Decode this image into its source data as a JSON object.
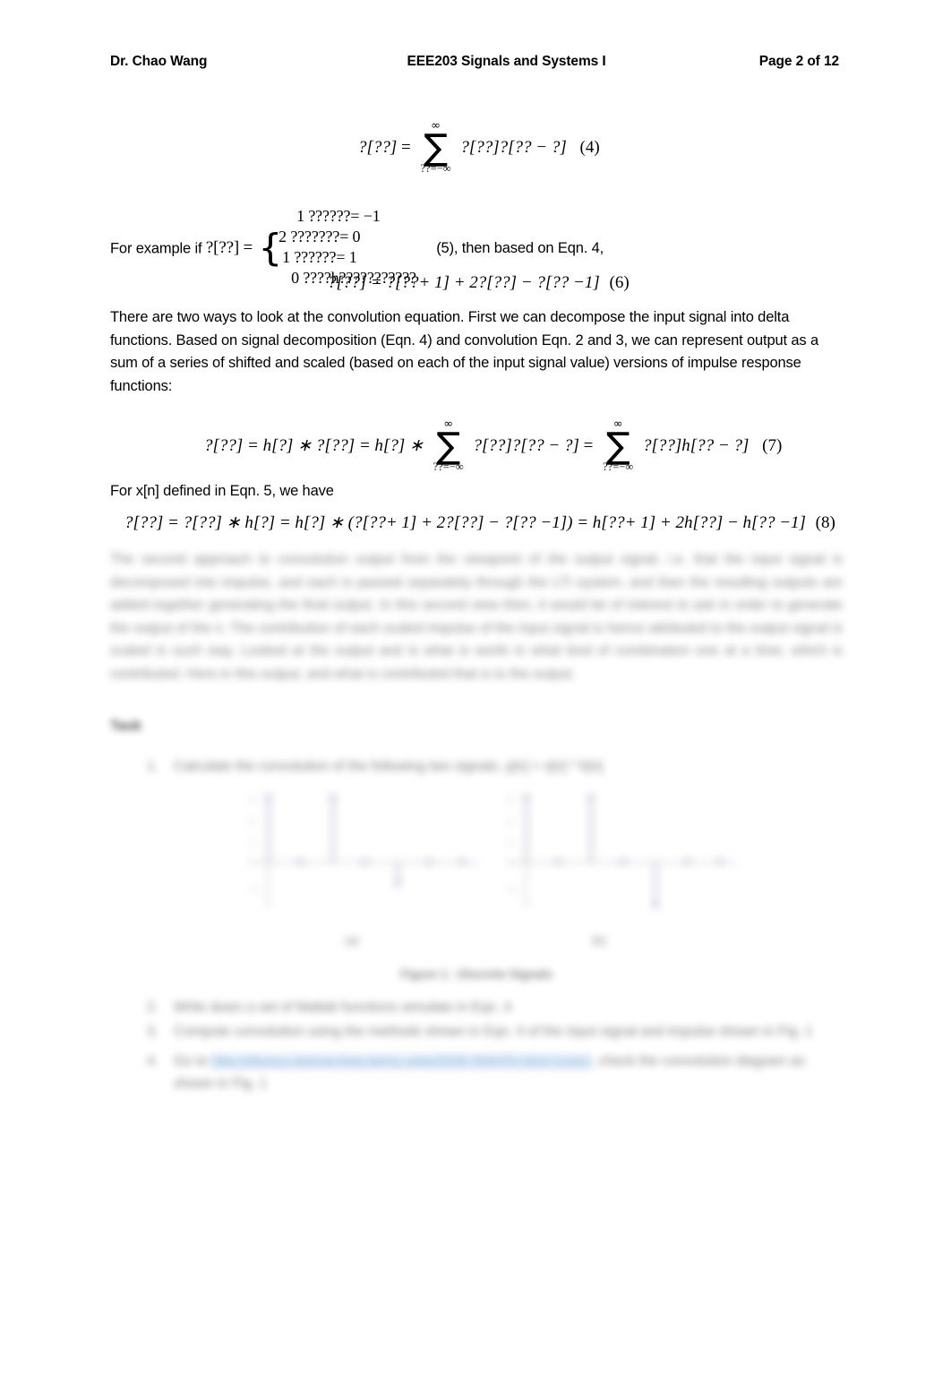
{
  "header": {
    "left": "Dr. Chao Wang",
    "center": "EEE203 Signals and Systems I",
    "right": "Page 2 of 12"
  },
  "equations": {
    "eqn4": {
      "lhs": "?[??]",
      "equals": "=",
      "sum_top": "∞",
      "sum_bottom": "??=−∞",
      "summand": "?[??]?[?? − ?]",
      "number": "(4)"
    },
    "eqn5": {
      "lead_text": "For example if",
      "lhs": "?[??]",
      "equals": "=",
      "brace": "{",
      "cases": [
        "1 ??????= −1",
        "2 ?????⁠??= 0",
        "1 ??????= 1",
        "0 ????h???????????"
      ],
      "number": "(5)",
      "tail_text": "(5), then based on Eqn. 4,"
    },
    "eqn6": {
      "text": "?[??] = ?[??+ 1] + 2?[??] − ?[?? −1]",
      "number": "(6)"
    },
    "eqn7": {
      "part1": "?[??] = h[?] ∗ ?[??] = h[?] ∗",
      "sum1_top": "∞",
      "sum1_bottom": "??=−∞",
      "summand1": "?[??]?[?? − ?]",
      "mid": "=",
      "sum2_top": "∞",
      "sum2_bottom": "??=−∞",
      "summand2": "?[??]h[?? − ?]",
      "number": "(7)"
    },
    "eqn8": {
      "text": "?[??] = ?[??] ∗ h[?] = h[?] ∗ (?[??+ 1] + 2?[??] − ?[?? −1]) = h[??+ 1] + 2h[??] − h[?? −1]",
      "number": "(8)"
    }
  },
  "paragraphs": {
    "p1": "There are two ways to look at the convolution equation. First we can decompose the input signal into delta functions. Based on signal decomposition (Eqn. 4) and convolution Eqn. 2 and 3, we can represent output as a sum of a series of shifted and scaled (based on each of the input signal value) versions of impulse response functions:",
    "p2": "For x[n] defined in Eqn. 5, we have",
    "p3_blurred": "The second approach to convolution output from the viewpoint of the output signal, i.e. that the input signal is decomposed into impulse, and each is passed separately through the LTI system, and then the resulting outputs are added together generating the final output. In this second view then, it would be of interest to ask in order to generate the output of the n. The contribution of each scaled impulse of the input signal is hence attributed to the output signal is scaled in such way. Looked at the output and is what is worth in what kind of combination one at a time, which is contributed. Here in this output, and what is contributed that is to the output."
  },
  "task": {
    "heading": "Task",
    "items": [
      {
        "num": "1.",
        "text_blurred": "Calculate the convolution of the following two signals, y[n] = x[n] * h[n]"
      },
      {
        "num": "2.",
        "text_blurred": "Write down a set of Matlab functions simulate in Eqn. 4"
      },
      {
        "num": "3.",
        "text_blurred": "Compute convolution using the methods shown in Eqn. 4 of the input signal and impulse shown in Fig. 1"
      },
      {
        "num": "4.",
        "text_blurred_pre": "Go to",
        "link_text_blurred": "http://pfuncu.ntuhxw.hwg.tw/co.vxkp/2026 (link)(5).html (copy)",
        "text_blurred_post": ", check the convolution diagram as shown in Fig. 1"
      }
    ]
  },
  "figure": {
    "caption_blurred": "Figure 1 : Discrete Signals",
    "sublabels": {
      "a": "(a)",
      "b": "(b)"
    },
    "plots": [
      {
        "id": "a",
        "ytick_labels": [
          "3",
          "2",
          "1",
          "0",
          "-1"
        ],
        "stems": [
          {
            "n": 0,
            "value": 3
          },
          {
            "n": 1,
            "value": 0
          },
          {
            "n": 2,
            "value": 3
          },
          {
            "n": 3,
            "value": 0
          },
          {
            "n": 4,
            "value": -1
          },
          {
            "n": 5,
            "value": 0
          },
          {
            "n": 6,
            "value": 0
          }
        ]
      },
      {
        "id": "b",
        "ytick_labels": [
          "3",
          "2",
          "1",
          "0",
          "-1"
        ],
        "stems": [
          {
            "n": 0,
            "value": 3
          },
          {
            "n": 1,
            "value": 0
          },
          {
            "n": 2,
            "value": 3
          },
          {
            "n": 3,
            "value": 0
          },
          {
            "n": 4,
            "value": -2
          },
          {
            "n": 5,
            "value": 0
          },
          {
            "n": 6,
            "value": 0
          }
        ]
      }
    ]
  },
  "colors": {
    "link": "#3d85c8",
    "link_highlight": "#dce9f6",
    "stem": "#4a4a8a",
    "axis": "#555555",
    "page_background": "#ffffff"
  }
}
